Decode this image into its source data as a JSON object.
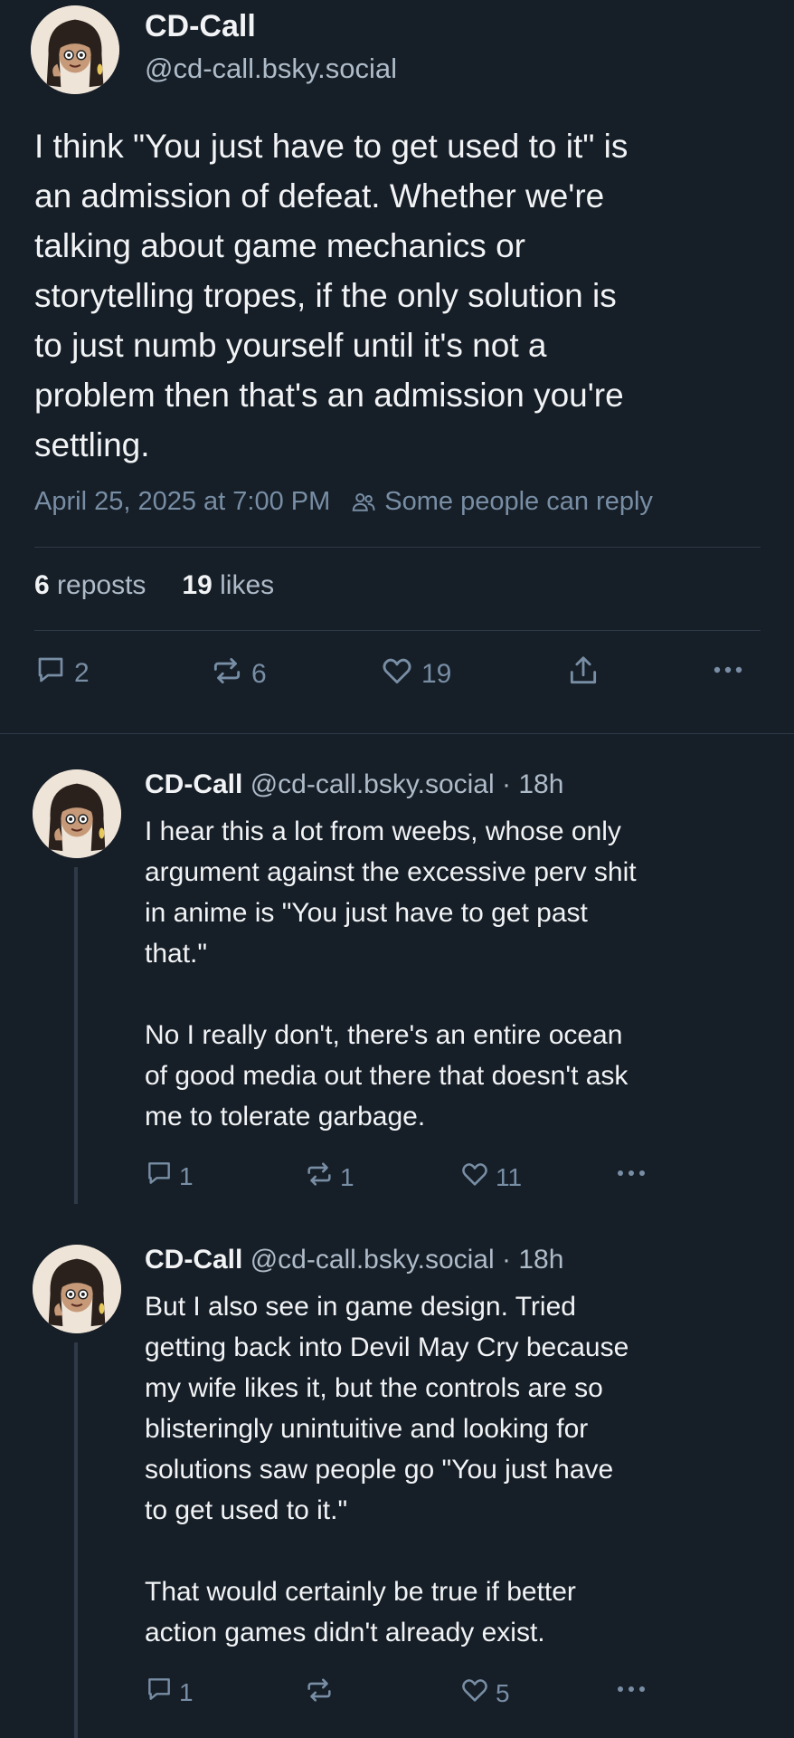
{
  "main_post": {
    "author_name": "CD-Call",
    "author_handle": "@cd-call.bsky.social",
    "text": "I think \"You just have to get used to it\" is\nan admission of defeat. Whether we're\ntalking about game mechanics or\nstorytelling tropes, if the only solution is\nto just numb yourself until it's not a\nproblem then that's an admission you're\nsettling.",
    "timestamp": "April 25, 2025 at 7:00 PM",
    "reply_setting": "Some people can reply",
    "reposts_count": "6",
    "reposts_label": "reposts",
    "likes_count": "19",
    "likes_label": "likes",
    "actions": {
      "reply_count": "2",
      "repost_count": "6",
      "like_count": "19"
    }
  },
  "replies": [
    {
      "author_name": "CD-Call",
      "author_handle": "@cd-call.bsky.social",
      "separator": "·",
      "time": "18h",
      "text": "I hear this a lot from weebs, whose only\nargument against the excessive perv shit\nin anime is \"You just have to get past\nthat.\"\n\nNo I really don't, there's an entire ocean\nof good media out there that doesn't ask\nme to tolerate garbage.",
      "reply_count": "1",
      "repost_count": "1",
      "like_count": "11"
    },
    {
      "author_name": "CD-Call",
      "author_handle": "@cd-call.bsky.social",
      "separator": "·",
      "time": "18h",
      "text": "But I also see in game design. Tried\ngetting back into Devil May Cry because\nmy wife likes it, but the controls are so\nblisteringly unintuitive and looking for\nsolutions saw people go \"You just have\nto get used to it.\"\n\nThat would certainly be true if better\naction games didn't already exist.",
      "reply_count": "1",
      "repost_count": "",
      "like_count": "5"
    }
  ],
  "icons": [
    "avatar",
    "people-icon",
    "reply-icon",
    "repost-icon",
    "like-icon",
    "share-icon",
    "more-icon"
  ],
  "colors": {
    "background": "#161e27",
    "text_primary": "#f1f3f5",
    "text_secondary": "#aebbc9",
    "text_muted": "#788ea5",
    "divider": "#2e3a48"
  }
}
